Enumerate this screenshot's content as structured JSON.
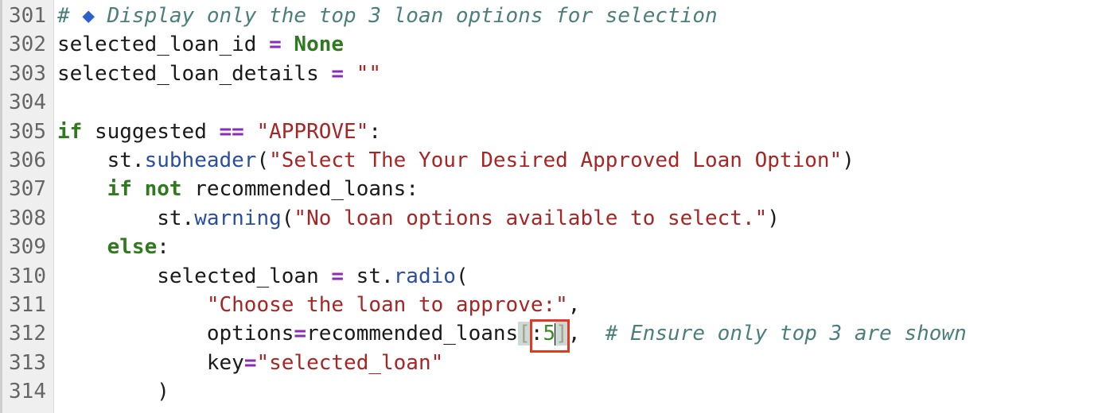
{
  "editor": {
    "lines": [
      {
        "number": "301",
        "tokens": [
          [
            "comment",
            "# "
          ],
          [
            "diamond",
            "◆"
          ],
          [
            "comment",
            " Display only the top 3 loan options for selection"
          ]
        ]
      },
      {
        "number": "302",
        "tokens": [
          [
            "plain",
            "selected_loan_id "
          ],
          [
            "op",
            "="
          ],
          [
            "plain",
            " "
          ],
          [
            "kw",
            "None"
          ]
        ]
      },
      {
        "number": "303",
        "tokens": [
          [
            "plain",
            "selected_loan_details "
          ],
          [
            "op",
            "="
          ],
          [
            "plain",
            " "
          ],
          [
            "str",
            "\"\""
          ]
        ]
      },
      {
        "number": "304",
        "tokens": []
      },
      {
        "number": "305",
        "tokens": [
          [
            "kw",
            "if"
          ],
          [
            "plain",
            " suggested "
          ],
          [
            "op",
            "=="
          ],
          [
            "plain",
            " "
          ],
          [
            "str",
            "\"APPROVE\""
          ],
          [
            "plain",
            ":"
          ]
        ]
      },
      {
        "number": "306",
        "tokens": [
          [
            "plain",
            "    st."
          ],
          [
            "fn",
            "subheader"
          ],
          [
            "plain",
            "("
          ],
          [
            "str",
            "\"Select The Your Desired Approved Loan Option\""
          ],
          [
            "plain",
            ")"
          ]
        ]
      },
      {
        "number": "307",
        "tokens": [
          [
            "plain",
            "    "
          ],
          [
            "kw",
            "if"
          ],
          [
            "plain",
            " "
          ],
          [
            "kw",
            "not"
          ],
          [
            "plain",
            " recommended_loans:"
          ]
        ]
      },
      {
        "number": "308",
        "tokens": [
          [
            "plain",
            "        st."
          ],
          [
            "fn",
            "warning"
          ],
          [
            "plain",
            "("
          ],
          [
            "str",
            "\"No loan options available to select.\""
          ],
          [
            "plain",
            ")"
          ]
        ]
      },
      {
        "number": "309",
        "tokens": [
          [
            "plain",
            "    "
          ],
          [
            "kw",
            "else"
          ],
          [
            "plain",
            ":"
          ]
        ]
      },
      {
        "number": "310",
        "tokens": [
          [
            "plain",
            "        selected_loan "
          ],
          [
            "op",
            "="
          ],
          [
            "plain",
            " st."
          ],
          [
            "fn",
            "radio"
          ],
          [
            "plain",
            "("
          ]
        ]
      },
      {
        "number": "311",
        "tokens": [
          [
            "plain",
            "            "
          ],
          [
            "str",
            "\"Choose the loan to approve:\""
          ],
          [
            "plain",
            ","
          ]
        ]
      },
      {
        "number": "312",
        "tokens": [
          [
            "plain",
            "            options"
          ],
          [
            "op",
            "="
          ],
          [
            "plain",
            "recommended_loans"
          ],
          [
            "bracket",
            "["
          ],
          [
            "plain",
            ":"
          ],
          [
            "num",
            "5"
          ],
          [
            "cursor",
            ""
          ],
          [
            "bracket",
            "]"
          ],
          [
            "plain",
            ",  "
          ],
          [
            "comment",
            "# Ensure only top 3 are shown"
          ]
        ]
      },
      {
        "number": "313",
        "tokens": [
          [
            "plain",
            "            key"
          ],
          [
            "op",
            "="
          ],
          [
            "str",
            "\"selected_loan\""
          ]
        ]
      },
      {
        "number": "314",
        "tokens": [
          [
            "plain",
            "        )"
          ]
        ]
      }
    ]
  }
}
